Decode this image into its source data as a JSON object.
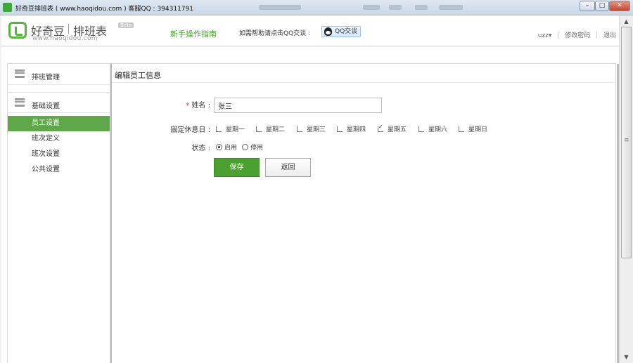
{
  "window": {
    "title": "好奇豆排班表 ( www.haoqidou.com )   客服QQ : 394311791",
    "controls": {
      "minimize": "–",
      "maximize": "□",
      "close": "✕"
    }
  },
  "header": {
    "logo_name": "好奇豆",
    "logo_product": "排班表",
    "logo_url": "www.haoqidou.com",
    "logo_badge": "Beta",
    "guide_link": "新手操作指南",
    "help_text": "如需帮助请点击QQ交谈 :",
    "qq_button": "QQ交谈",
    "user": "uzz",
    "change_password": "修改密码",
    "logout": "退出"
  },
  "sidebar": {
    "groups": [
      {
        "label": "排班管理",
        "icon": "list-icon"
      },
      {
        "label": "基础设置",
        "icon": "list-icon"
      }
    ],
    "items": [
      {
        "label": "员工设置",
        "active": true
      },
      {
        "label": "班次定义",
        "active": false
      },
      {
        "label": "班次设置",
        "active": false
      },
      {
        "label": "公共设置",
        "active": false
      }
    ]
  },
  "form": {
    "title": "编辑员工信息",
    "name_required_mark": "*",
    "name_label": "姓名 :",
    "name_value": "张三",
    "rest_label": "固定休息日 :",
    "days": [
      {
        "label": "星期一",
        "checked": false
      },
      {
        "label": "星期二",
        "checked": false
      },
      {
        "label": "星期三",
        "checked": false
      },
      {
        "label": "星期四",
        "checked": false
      },
      {
        "label": "星期五",
        "checked": true
      },
      {
        "label": "星期六",
        "checked": false
      },
      {
        "label": "星期日",
        "checked": false
      }
    ],
    "status_label": "状态 :",
    "status_options": [
      {
        "label": "启用",
        "selected": true
      },
      {
        "label": "停用",
        "selected": false
      }
    ],
    "save_button": "保存",
    "back_button": "返回"
  },
  "colors": {
    "accent_green": "#4aa12f",
    "sidebar_active": "#5fa84a",
    "required": "#d23c2a"
  }
}
